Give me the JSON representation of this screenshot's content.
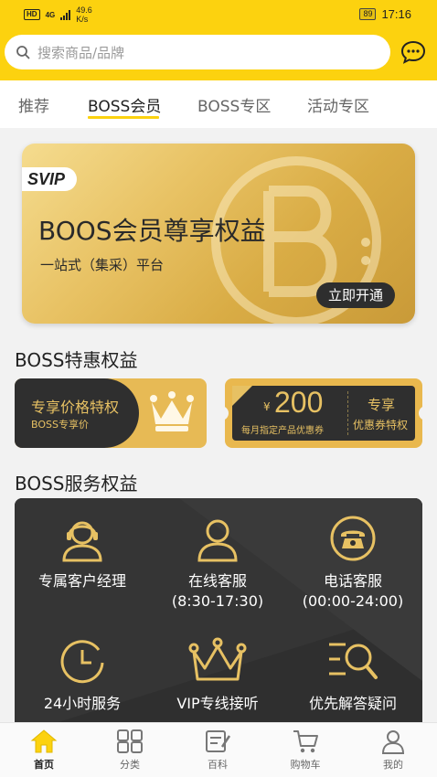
{
  "status_bar": {
    "network_badge": "HD",
    "network_type": "4G",
    "speed_value": "49.6",
    "speed_unit": "K/s",
    "battery": "89",
    "time": "17:16"
  },
  "search": {
    "placeholder": "搜索商品/品牌"
  },
  "tabs": [
    {
      "label": "推荐"
    },
    {
      "label": "BOSS会员",
      "active": true
    },
    {
      "label": "BOSS专区"
    },
    {
      "label": "活动专区"
    }
  ],
  "banner": {
    "tag": "SVIP",
    "title": "BOOS会员尊享权益",
    "subtitle": "一站式（集采）平台",
    "button": "立即开通"
  },
  "benefits": {
    "title": "BOSS特惠权益",
    "price_card": {
      "title": "专享价格特权",
      "subtitle": "BOSS专享价"
    },
    "coupon_card": {
      "currency": "¥",
      "amount": "200",
      "desc": "每月指定产品优惠券",
      "right_title": "专享",
      "right_sub": "优惠券特权"
    }
  },
  "services": {
    "title": "BOSS服务权益",
    "items": [
      {
        "label": "专属客户经理",
        "sub": ""
      },
      {
        "label": "在线客服",
        "sub": "(8:30-17:30)"
      },
      {
        "label": "电话客服",
        "sub": "(00:00-24:00)"
      },
      {
        "label": "24小时服务",
        "sub": ""
      },
      {
        "label": "VIP专线接听",
        "sub": ""
      },
      {
        "label": "优先解答疑问",
        "sub": ""
      }
    ]
  },
  "bottom_nav": [
    {
      "label": "首页",
      "icon": "home-icon",
      "active": true
    },
    {
      "label": "分类",
      "icon": "category-icon"
    },
    {
      "label": "百科",
      "icon": "encyclopedia-icon"
    },
    {
      "label": "购物车",
      "icon": "cart-icon"
    },
    {
      "label": "我的",
      "icon": "profile-icon"
    }
  ],
  "colors": {
    "brand_yellow": "#fcd20f",
    "gold": "#e7c163",
    "dark": "#2f2f2f"
  }
}
